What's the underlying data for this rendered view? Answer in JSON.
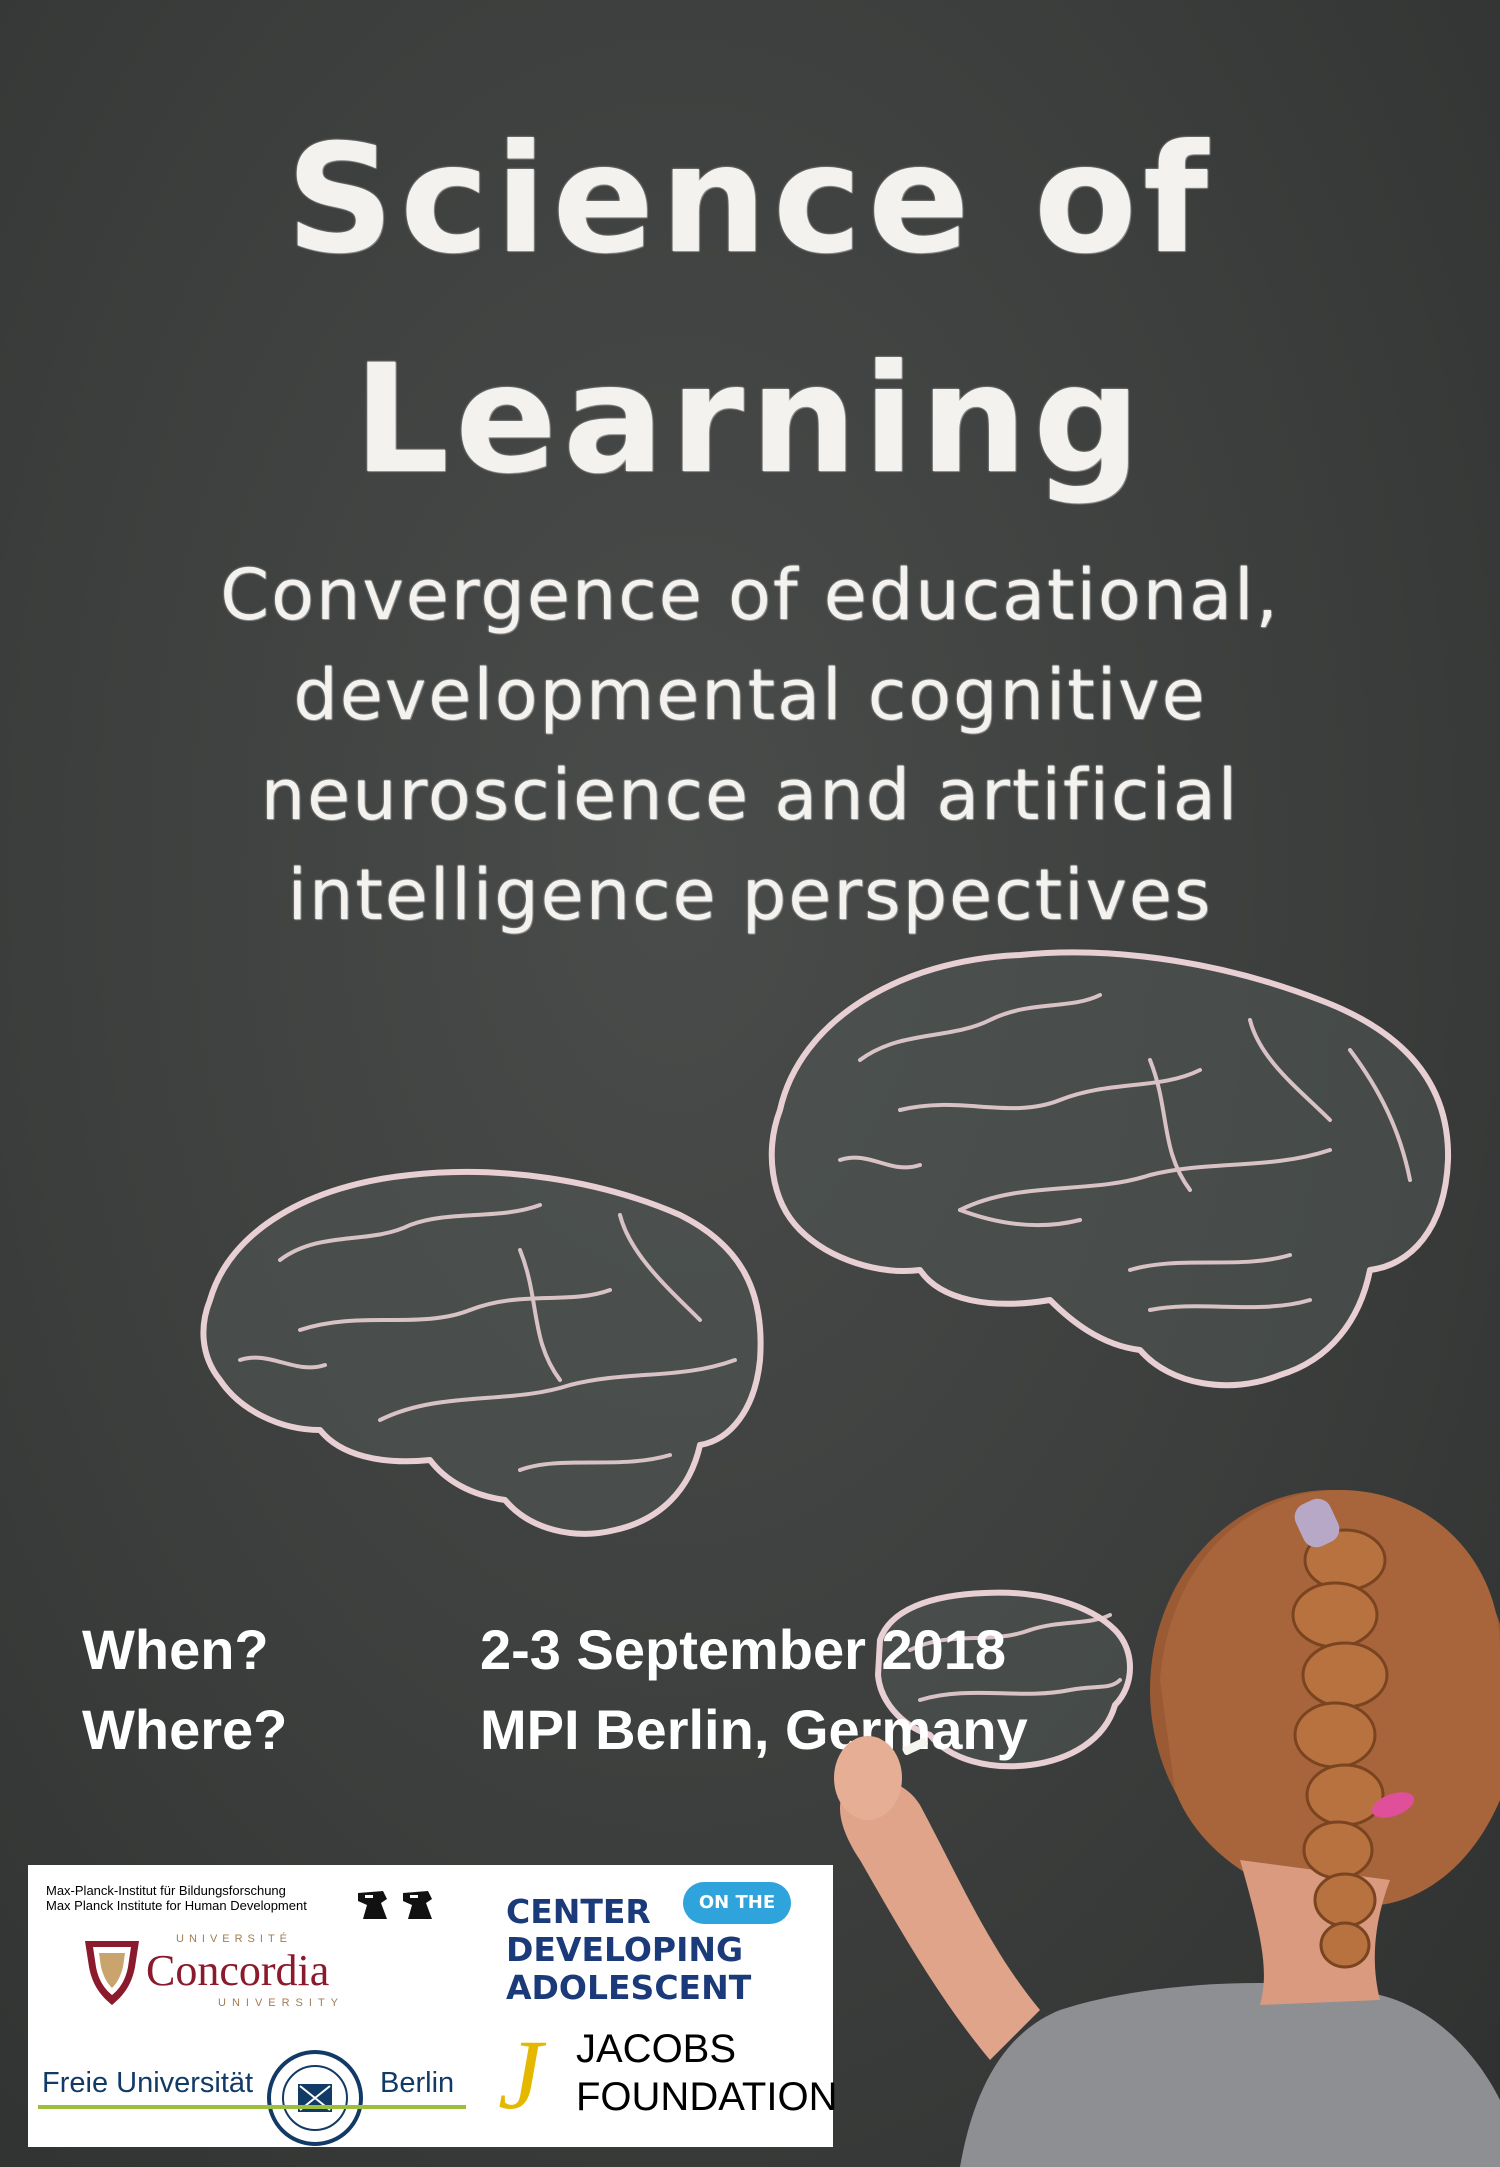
{
  "title": {
    "line1": "Science of",
    "line2": "Learning"
  },
  "subtitle": {
    "line1": "Convergence of educational,",
    "line2": "developmental cognitive",
    "line3": "neuroscience and artificial",
    "line4": "intelligence perspectives"
  },
  "event": {
    "when_label": "When?",
    "when_value": "2-3 September 2018",
    "where_label": "Where?",
    "where_value": "MPI Berlin, Germany"
  },
  "logos": {
    "mpi_de": "Max-Planck-Institut für Bildungsforschung",
    "mpi_en": "Max Planck Institute for Human Development",
    "concordia_top": "UNIVERSITÉ",
    "concordia_name": "Concordia",
    "concordia_bottom": "UNIVERSITY",
    "fu_left": "Freie Universität",
    "fu_right": "Berlin",
    "cda_bubble": "ON THE",
    "cda_line1": "CENTER",
    "cda_line2": "DEVELOPING",
    "cda_line3": "ADOLESCENT",
    "jacobs_line1": "JACOBS",
    "jacobs_line2": "FOUNDATION"
  },
  "colors": {
    "chalkboard": "#3b3d3c",
    "chalk": "#f4f2ee",
    "brain_outline": "#e8cfd3",
    "concordia": "#8a1a2c",
    "fu_blue": "#123a66",
    "cda_navy": "#1b3a7a",
    "cda_blue": "#2ea3dc",
    "jacobs_yellow": "#e5b800"
  }
}
